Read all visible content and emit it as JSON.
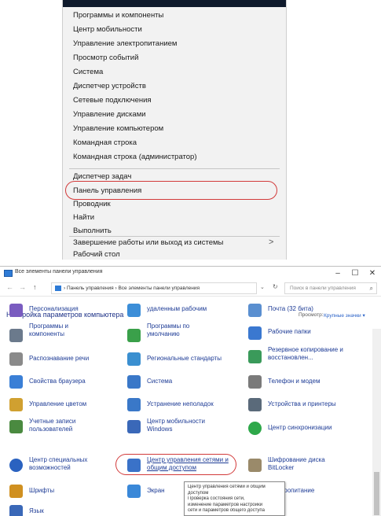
{
  "top_caption": "",
  "context_menu": {
    "items": [
      {
        "label": "Программы и компоненты"
      },
      {
        "label": "Центр мобильности"
      },
      {
        "label": "Управление электропитанием"
      },
      {
        "label": "Просмотр событий"
      },
      {
        "label": "Система"
      },
      {
        "label": "Диспетчер устройств"
      },
      {
        "label": "Сетевые подключения"
      },
      {
        "label": "Управление дисками"
      },
      {
        "label": "Управление компьютером"
      },
      {
        "label": "Командная строка"
      },
      {
        "label": "Командная строка (администратор)"
      },
      {
        "label": "Диспетчер задач"
      },
      {
        "label": "Панель управления",
        "highlighted": true
      },
      {
        "label": "Проводник"
      },
      {
        "label": "Найти"
      },
      {
        "label": "Выполнить"
      },
      {
        "label": "Завершение работы или выход из системы",
        "has_submenu": true
      },
      {
        "label": "Рабочий стол"
      }
    ],
    "submenu_glyph": ">"
  },
  "control_panel": {
    "window_title": "Все элементы панели управления",
    "window_buttons": {
      "minimize": "–",
      "maximize": "☐",
      "close": "✕"
    },
    "nav": {
      "back": "←",
      "forward": "→",
      "up": "↑"
    },
    "breadcrumb": "› Панель управления › Все элементы панели управления",
    "search_placeholder": "Поиск в панели управления",
    "heading": "Настройка параметров компьютера",
    "view_label": "Просмотр:",
    "view_value": "Крупные значки ▾",
    "items": [
      {
        "label": "Персонализация",
        "icon": "personalization-icon",
        "color": "#7a5cc0"
      },
      {
        "label": "удаленным рабочим",
        "icon": "remote-desktop-icon",
        "color": "#3c8ed8"
      },
      {
        "label": "Почта (32 бита)",
        "icon": "mail-icon",
        "color": "#5a8fd0"
      },
      {
        "label": "Программы и компоненты",
        "icon": "programs-icon",
        "color": "#6b7a8c"
      },
      {
        "label": "Программы по умолчанию",
        "icon": "default-programs-icon",
        "color": "#3aa04a"
      },
      {
        "label": "Рабочие папки",
        "icon": "work-folders-icon",
        "color": "#3a78d0"
      },
      {
        "label": "Распознавание речи",
        "icon": "speech-icon",
        "color": "#8a8a8a"
      },
      {
        "label": "Региональные стандарты",
        "icon": "region-icon",
        "color": "#3a8fd0"
      },
      {
        "label": "Резервное копирование и восстановлен...",
        "icon": "backup-icon",
        "color": "#3a9a5a"
      },
      {
        "label": "Свойства браузера",
        "icon": "browser-icon",
        "color": "#3a7fd6"
      },
      {
        "label": "Система",
        "icon": "system-icon",
        "color": "#3a78c8"
      },
      {
        "label": "Телефон и модем",
        "icon": "phone-icon",
        "color": "#7a7a7a"
      },
      {
        "label": "Управление цветом",
        "icon": "color-management-icon",
        "color": "#d0a030"
      },
      {
        "label": "Устранение неполадок",
        "icon": "troubleshoot-icon",
        "color": "#3a78c8"
      },
      {
        "label": "Устройства и принтеры",
        "icon": "printer-icon",
        "color": "#5a6a7a"
      },
      {
        "label": "Учетные записи пользователей",
        "icon": "user-accounts-icon",
        "color": "#4a8a40"
      },
      {
        "label": "Центр мобильности Windows",
        "icon": "mobility-icon",
        "color": "#3a68b8"
      },
      {
        "label": "Центр синхронизации",
        "icon": "sync-icon",
        "color": "#2ea84a"
      },
      {
        "label": "Центр специальных возможностей",
        "icon": "accessibility-icon",
        "color": "#2a62c0"
      },
      {
        "label": "Центр управления сетями и общим доступом",
        "icon": "network-center-icon",
        "color": "#3a72c8",
        "highlighted": true
      },
      {
        "label": "Шифрование диска BitLocker",
        "icon": "bitlocker-icon",
        "color": "#9a8a6a"
      },
      {
        "label": "Шрифты",
        "icon": "fonts-icon",
        "color": "#d09020"
      },
      {
        "label": "Экран",
        "icon": "display-icon",
        "color": "#3a88d8"
      },
      {
        "label": "электропитание",
        "icon": "power-icon",
        "color": "#4a9a4a"
      },
      {
        "label": "Язык",
        "icon": "language-icon",
        "color": "#3a68b8"
      }
    ],
    "tooltip": [
      "Центр управления сетями и общим",
      "доступом",
      "Проверка состояния сети,",
      "изменение параметров настройки",
      "сети и параметров общего доступа"
    ]
  }
}
